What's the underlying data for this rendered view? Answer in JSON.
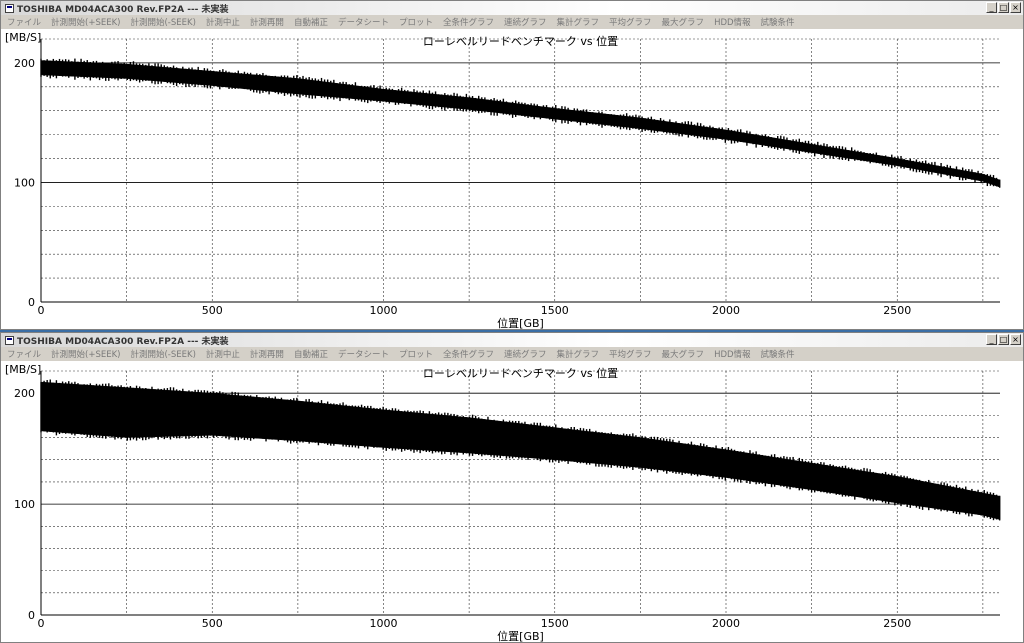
{
  "windows": [
    {
      "title": "TOSHIBA MD04ACA300 Rev.FP2A --- 未実装",
      "controls": [
        "_",
        "□",
        "×"
      ],
      "menu": [
        "ファイル",
        "計測開始(+SEEK)",
        "計測開始(-SEEK)",
        "計測中止",
        "計測再開",
        "自動補正",
        "データシート",
        "プロット",
        "全条件グラフ",
        "連続グラフ",
        "集計グラフ",
        "平均グラフ",
        "最大グラフ",
        "HDD情報",
        "試験条件"
      ],
      "chart_data": {
        "type": "area",
        "title": "ローレベルリードベンチマーク vs 位置",
        "xlabel": "位置[GB]",
        "ylabel": "[MB/S]",
        "xlim": [
          0,
          2800
        ],
        "ylim": [
          0,
          220
        ],
        "xticks": [
          "0",
          "500",
          "1000",
          "1500",
          "2000",
          "2500"
        ],
        "yticks": [
          "0",
          "100",
          "200"
        ],
        "grid": true,
        "series": [
          {
            "x": [
              0,
              250,
              500,
              750,
              1000,
              1250,
              1500,
              1750,
              2000,
              2250,
              2500,
              2750,
              2800
            ],
            "upper": [
              202,
              199,
              193,
              187,
              178,
              171,
              162,
              154,
              144,
              132,
              120,
              107,
              102
            ],
            "lower": [
              190,
              187,
              181,
              174,
              168,
              161,
              153,
              145,
              136,
              125,
              114,
              101,
              96
            ]
          }
        ]
      }
    },
    {
      "title": "TOSHIBA MD04ACA300 Rev.FP2A --- 未実装",
      "controls": [
        "_",
        "□",
        "×"
      ],
      "menu": [
        "ファイル",
        "計測開始(+SEEK)",
        "計測開始(-SEEK)",
        "計測中止",
        "計測再開",
        "自動補正",
        "データシート",
        "プロット",
        "全条件グラフ",
        "連続グラフ",
        "集計グラフ",
        "平均グラフ",
        "最大グラフ",
        "HDD情報",
        "試験条件"
      ],
      "chart_data": {
        "type": "area",
        "title": "ローレベルリードベンチマーク vs 位置",
        "xlabel": "位置[GB]",
        "ylabel": "[MB/S]",
        "xlim": [
          0,
          2800
        ],
        "ylim": [
          0,
          220
        ],
        "xticks": [
          "0",
          "500",
          "1000",
          "1500",
          "2000",
          "2500"
        ],
        "yticks": [
          "0",
          "100",
          "200"
        ],
        "grid": true,
        "series": [
          {
            "x": [
              0,
              250,
              500,
              750,
              1000,
              1250,
              1500,
              1750,
              2000,
              2250,
              2500,
              2750,
              2800
            ],
            "upper": [
              210,
              205,
              200,
              193,
              185,
              178,
              169,
              160,
              149,
              137,
              125,
              110,
              107
            ],
            "lower": [
              166,
              160,
              162,
              157,
              151,
              146,
              140,
              133,
              124,
              113,
              101,
              90,
              86
            ]
          }
        ]
      }
    }
  ]
}
